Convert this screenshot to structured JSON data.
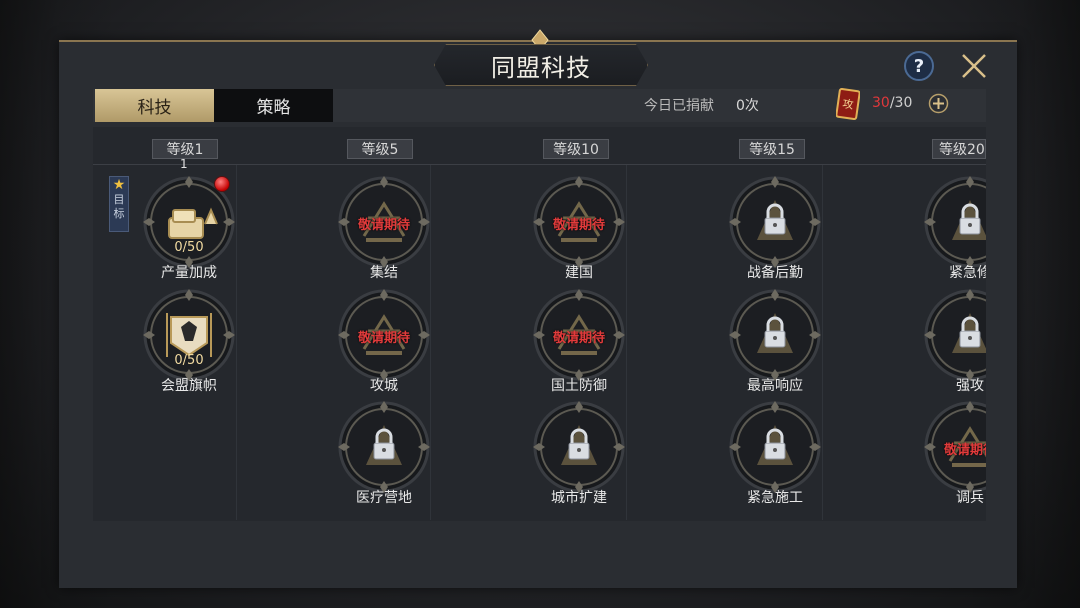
{
  "header": {
    "title": "同盟科技"
  },
  "tabs": [
    {
      "label": "科技",
      "active": true
    },
    {
      "label": "策略",
      "active": false
    }
  ],
  "donation": {
    "label": "今日已捐献",
    "value": "0次"
  },
  "quota": {
    "current": "30",
    "separator": "/",
    "max": "30"
  },
  "target_label": {
    "star": "★",
    "chars": [
      "目",
      "标"
    ]
  },
  "levels": [
    "等级1",
    "等级5",
    "等级10",
    "等级15",
    "等级20"
  ],
  "level1_count": "1",
  "coming_soon": "敬请期待",
  "nodes": {
    "c1": [
      {
        "name": "产量加成",
        "progress": "0/50",
        "icon": "production-crate-icon"
      },
      {
        "name": "会盟旗帜",
        "progress": "0/50",
        "icon": "alliance-banner-icon"
      }
    ],
    "c2": [
      {
        "name": "集结",
        "icon": "rally-swords-icon"
      },
      {
        "name": "攻城",
        "icon": "siege-crown-icon"
      },
      {
        "name": "医疗营地",
        "icon": "medical-camp-locked-icon"
      }
    ],
    "c3": [
      {
        "name": "建国",
        "icon": "nation-founding-icon"
      },
      {
        "name": "国土防御",
        "icon": "territory-defense-icon"
      },
      {
        "name": "城市扩建",
        "icon": "city-expansion-locked-icon"
      }
    ],
    "c4": [
      {
        "name": "战备后勤",
        "icon": "logistics-locked-icon"
      },
      {
        "name": "最高响应",
        "icon": "highest-response-locked-icon"
      },
      {
        "name": "紧急施工",
        "icon": "emergency-construction-locked-icon"
      }
    ],
    "c5": [
      {
        "name": "紧急修"
      },
      {
        "name": "强攻"
      },
      {
        "name": "调兵"
      }
    ]
  },
  "colors": {
    "accent_gold": "#d8c596",
    "alert_red": "#e0383b",
    "panel": "#2a2d32"
  }
}
